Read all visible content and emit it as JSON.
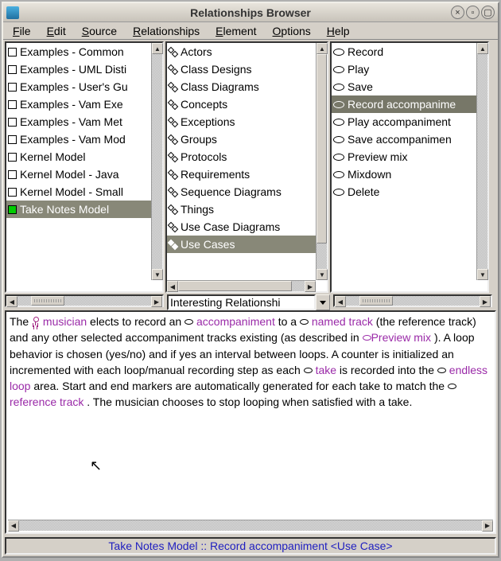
{
  "window": {
    "title": "Relationships Browser"
  },
  "menu": {
    "file": {
      "label": "File",
      "ul": "F"
    },
    "edit": {
      "label": "Edit",
      "ul": "E"
    },
    "source": {
      "label": "Source",
      "ul": "S"
    },
    "rel": {
      "label": "Relationships",
      "ul": "R"
    },
    "elem": {
      "label": "Element",
      "ul": "E"
    },
    "opts": {
      "label": "Options",
      "ul": "O"
    },
    "help": {
      "label": "Help",
      "ul": "H"
    }
  },
  "left_pane": {
    "items": [
      {
        "label": "Examples - Common"
      },
      {
        "label": "Examples - UML Disti"
      },
      {
        "label": "Examples - User's Gu"
      },
      {
        "label": "Examples - Vam Exe"
      },
      {
        "label": "Examples - Vam Met"
      },
      {
        "label": "Examples - Vam Mod"
      },
      {
        "label": "Kernel Model"
      },
      {
        "label": "Kernel Model - Java"
      },
      {
        "label": "Kernel Model - Small"
      },
      {
        "label": "Take Notes Model",
        "selected": true
      }
    ]
  },
  "mid_pane": {
    "items": [
      {
        "label": "Actors"
      },
      {
        "label": "Class Designs"
      },
      {
        "label": "Class Diagrams"
      },
      {
        "label": "Concepts"
      },
      {
        "label": "Exceptions"
      },
      {
        "label": "Groups"
      },
      {
        "label": "Protocols"
      },
      {
        "label": "Requirements"
      },
      {
        "label": "Sequence Diagrams"
      },
      {
        "label": "Things"
      },
      {
        "label": "Use Case Diagrams"
      },
      {
        "label": "Use Cases",
        "selected": true
      }
    ]
  },
  "right_pane": {
    "items": [
      {
        "label": "Record"
      },
      {
        "label": "Play"
      },
      {
        "label": "Save"
      },
      {
        "label": "Record accompanime",
        "selected": true
      },
      {
        "label": "Play accompaniment"
      },
      {
        "label": "Save accompanimen"
      },
      {
        "label": "Preview mix"
      },
      {
        "label": "Mixdown"
      },
      {
        "label": "Delete"
      }
    ]
  },
  "dropdown": {
    "label": "Interesting Relationshi"
  },
  "detail": {
    "t0": "The ",
    "musician": "musician",
    "t1": " elects to record an ",
    "accompaniment": "accompaniment",
    "t2": " to a ",
    "named_track": "named track",
    "t3": " (the reference track) and any other selected accompaniment tracks existing (as described in ",
    "preview_mix": "Preview mix",
    "t4": ").  A loop behavior is chosen (yes/no) and if yes an interval between loops.  A counter is initialized an incremented with each loop/manual recording step as each ",
    "take": "take",
    "t5": " is recorded into the ",
    "endless_loop": "endless loop",
    "t6": " area.  Start and end markers are automatically generated for each take to match the ",
    "reference_track": "reference track",
    "t7": ".  The musician chooses to stop looping when satisfied with a take."
  },
  "status": {
    "text": "Take Notes Model :: Record accompaniment <Use Case>"
  }
}
